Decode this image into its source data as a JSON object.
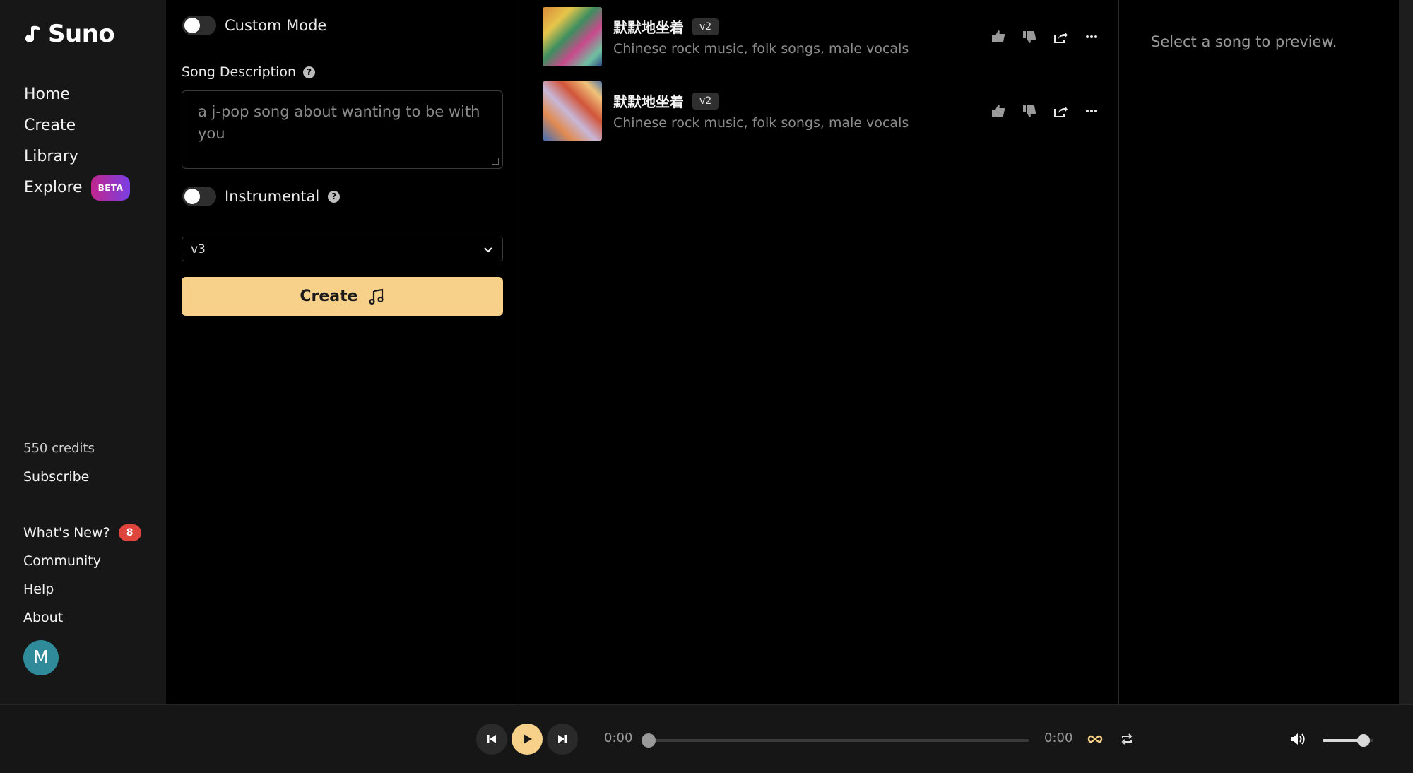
{
  "app": {
    "name": "Suno"
  },
  "sidebar": {
    "nav": [
      {
        "label": "Home"
      },
      {
        "label": "Create"
      },
      {
        "label": "Library"
      },
      {
        "label": "Explore",
        "badge": "BETA"
      }
    ],
    "credits": "550 credits",
    "subscribe": "Subscribe",
    "links": [
      {
        "label": "What's New?",
        "badge": "8"
      },
      {
        "label": "Community"
      },
      {
        "label": "Help"
      },
      {
        "label": "About"
      }
    ],
    "avatar_initial": "M"
  },
  "form": {
    "custom_mode_label": "Custom Mode",
    "custom_mode_on": false,
    "song_description_label": "Song Description",
    "song_description_value": "a  j-pop song about wanting to be with you",
    "instrumental_label": "Instrumental",
    "instrumental_on": false,
    "model_selected": "v3",
    "create_label": "Create"
  },
  "songs": [
    {
      "title": "默默地坐着",
      "version": "v2",
      "tags": "Chinese rock music, folk songs, male vocals"
    },
    {
      "title": "默默地坐着",
      "version": "v2",
      "tags": "Chinese rock music, folk songs, male vocals"
    }
  ],
  "preview": {
    "placeholder": "Select a song to preview."
  },
  "player": {
    "current_time": "0:00",
    "duration": "0:00",
    "progress": 0,
    "volume": 0.8
  },
  "colors": {
    "accent": "#f7d08a",
    "sidebar_bg": "#171717",
    "badge_red": "#e0453d",
    "avatar": "#2f8a9a"
  }
}
